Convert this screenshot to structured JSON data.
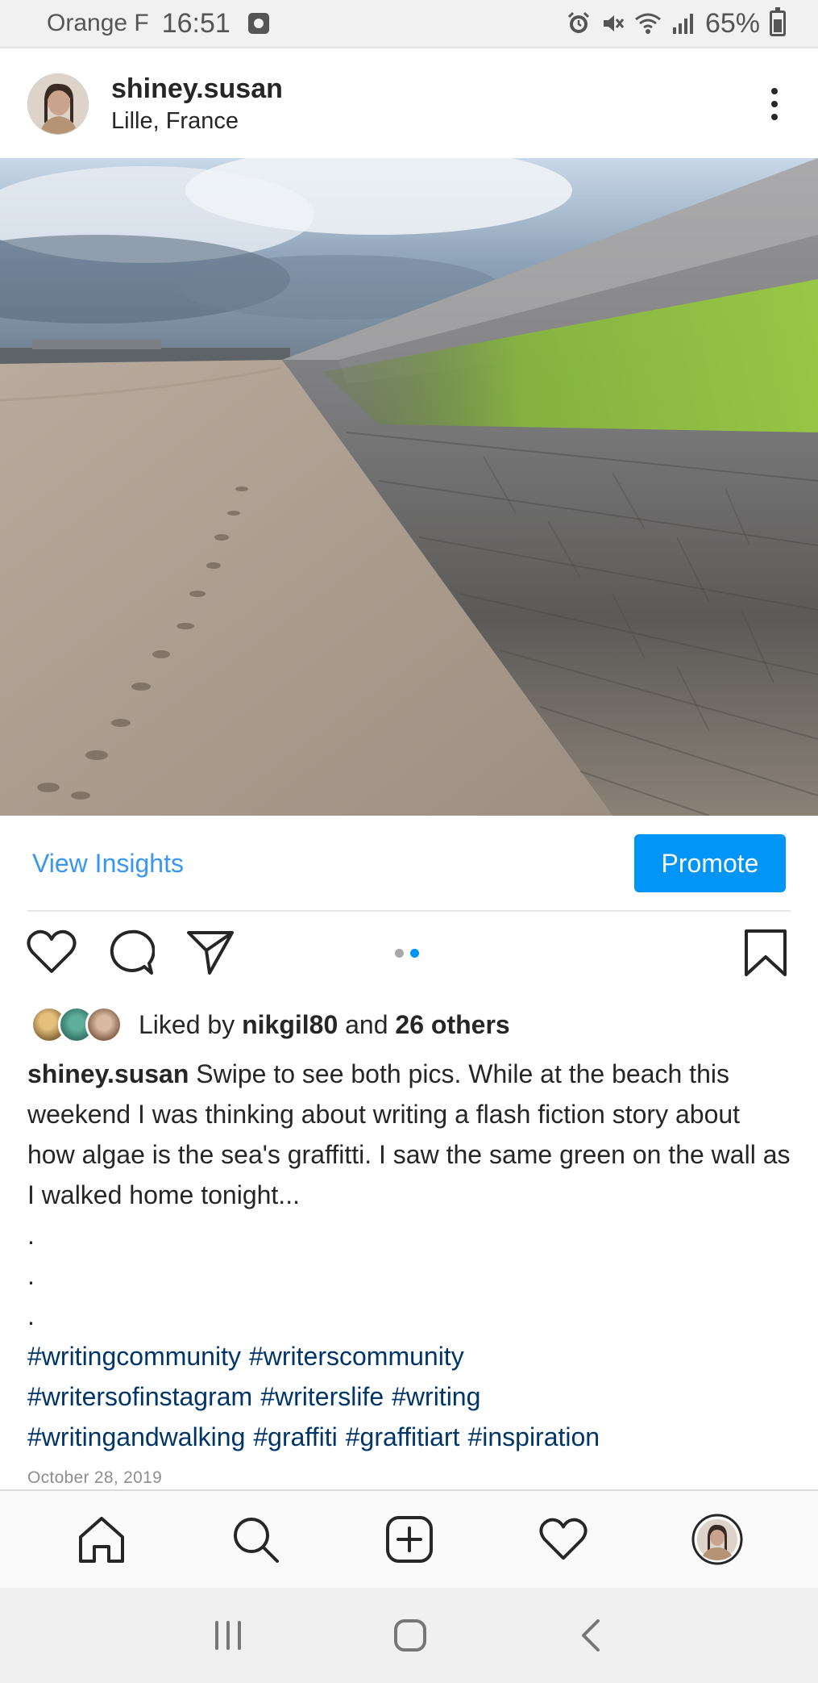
{
  "status_bar": {
    "carrier": "Orange F",
    "time": "16:51",
    "battery": "65%",
    "icons": [
      "clock-app-icon",
      "alarm-icon",
      "mute-icon",
      "wifi-icon",
      "signal-icon",
      "battery-icon"
    ]
  },
  "post": {
    "username": "shiney.susan",
    "location": "Lille, France",
    "insights_label": "View Insights",
    "promote_label": "Promote",
    "carousel": {
      "total": 2,
      "active": 2
    },
    "likes": {
      "prefix": "Liked by",
      "first_liker": "nikgil80",
      "conjunction": "and",
      "others": "26 others"
    },
    "caption_text": "Swipe to see both pics. While at the beach this weekend I was thinking about writing a flash fiction story about how algae is the sea's graffitti. I saw the same green on the wall as I walked home tonight...",
    "caption_dots": [
      ".",
      ".",
      "."
    ],
    "hashtags": [
      "#writingcommunity",
      "#writerscommunity",
      "#writersofinstagram",
      "#writerslife",
      "#writing",
      "#writingandwalking",
      "#graffiti",
      "#graffitiart",
      "#inspiration"
    ],
    "date": "October 28, 2019"
  },
  "bottom_nav": [
    "home-icon",
    "search-icon",
    "add-post-icon",
    "activity-heart-icon",
    "profile-avatar"
  ],
  "system_nav": [
    "recent-apps-icon",
    "home-button-icon",
    "back-icon"
  ],
  "colors": {
    "link": "#3897f0",
    "promote": "#0095f6",
    "hashtag": "#003569"
  }
}
